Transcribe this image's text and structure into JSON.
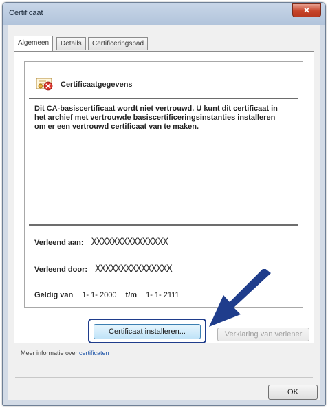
{
  "window": {
    "title": "Certificaat",
    "close_glyph": "✕"
  },
  "tabs": [
    {
      "label": "Algemeen",
      "active": true
    },
    {
      "label": "Details",
      "active": false
    },
    {
      "label": "Certificeringspad",
      "active": false
    }
  ],
  "info": {
    "icon": "certificate-warning-icon",
    "header": "Certificaatgegevens",
    "warning": "Dit CA-basiscertificaat wordt niet vertrouwd. U kunt dit certificaat in het archief met vertrouwde basiscertificeringsinstanties installeren om er een vertrouwd certificaat van te maken.",
    "issued_to_label": "Verleend aan:",
    "issued_to_value": "XXXXXXXXXXXXXXX",
    "issued_by_label": "Verleend door:",
    "issued_by_value": "XXXXXXXXXXXXXXX",
    "valid_from_label": "Geldig van",
    "valid_from_value": "1- 1- 2000",
    "valid_to_label": "t/m",
    "valid_to_value": "1- 1- 2111"
  },
  "buttons": {
    "install": "Certificaat installeren...",
    "issuer_statement": "Verklaring van verlener",
    "ok": "OK"
  },
  "more_info": {
    "prefix": "Meer informatie over",
    "link": "certificaten"
  },
  "annotation": {
    "arrow_color": "#1f3d8c"
  }
}
